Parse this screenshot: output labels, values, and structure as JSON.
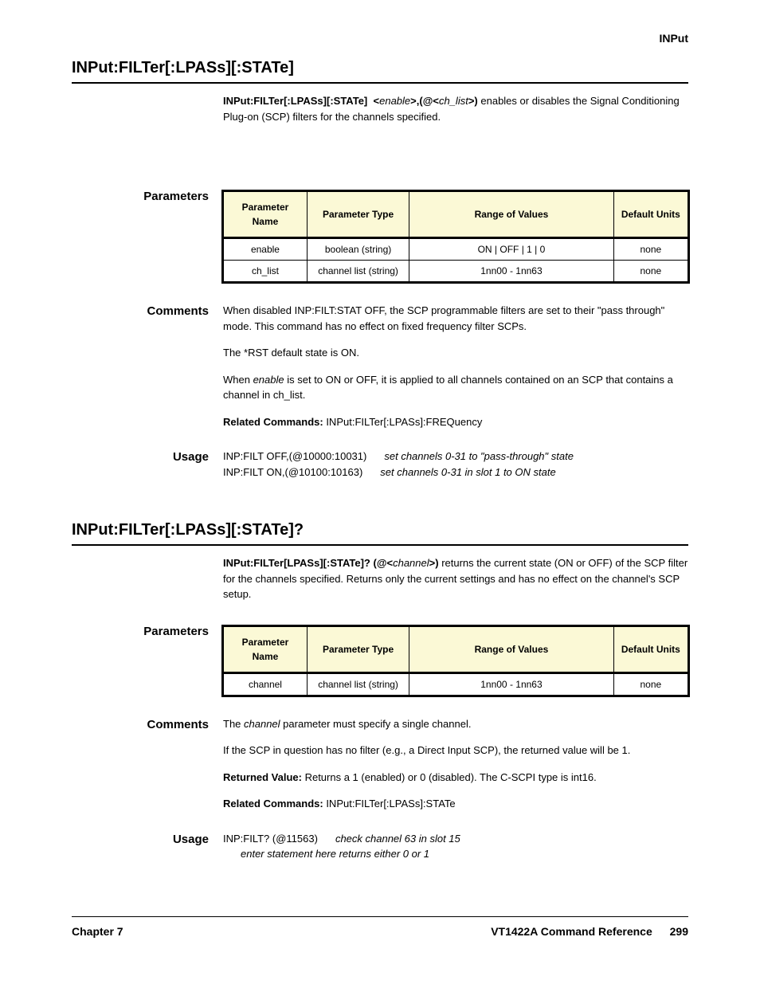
{
  "topLabel": "INPut",
  "section1": {
    "heading": "INPut:FILTer[:LPASs][:STATe]",
    "syntax": {
      "cmd": "INPut:FILTer[:LPASs][:STATe]",
      "arg1": "enable",
      "sep1": ",(@<",
      "arg2": "ch_list",
      "sep2": ">)"
    },
    "description": "enables or disables the Signal Conditioning Plug-on (SCP) filters for the channels specified.",
    "parametersLabel": "Parameters",
    "paramTable": {
      "headers": [
        "Parameter\nName",
        "Parameter\nType",
        "Range of\nValues",
        "Default\nUnits"
      ],
      "rows": [
        [
          "enable",
          "boolean (string)",
          "ON | OFF | 1 | 0",
          "none"
        ],
        [
          "ch_list",
          "channel list (string)",
          "1nn00 - 1nn63",
          "none"
        ]
      ]
    },
    "commentsLabel": "Comments",
    "comments": [
      {
        "prefix": "When disabled ",
        "bold1": "INP:FILT:STAT OFF",
        "mid": ", the SCP programmable filters are set to their \"pass through\" mode. This command has no effect on fixed frequency filter SCPs."
      },
      {
        "text": "The *RST default state is ON."
      },
      {
        "prefix": "When ",
        "ital": "enable",
        "mid": " is set to ON or OFF, it is applied to all channels contained on an SCP that contains a channel in ch_list."
      },
      {
        "type": "related",
        "label": "Related Commands:",
        "text": " INPut:FILTer[:LPASs]:FREQuency"
      }
    ],
    "usageLabel": "Usage",
    "usage": [
      {
        "cmd": "INP:FILT OFF,(@10000:10031)",
        "note": "set channels 0-31 to \"pass-through\" state"
      },
      {
        "cmd": "INP:FILT ON,(@10100:10163)",
        "note": "set channels 0-31 in slot 1 to ON state"
      }
    ]
  },
  "section2": {
    "heading": "INPut:FILTer[:LPASs][:STATe]?",
    "syntax": {
      "cmd": "INPut:FILTer[LPASs][:STATe]?",
      "pre": " (@<",
      "arg": "channel",
      "post": ">)"
    },
    "description": "returns the current state (ON or OFF) of the SCP filter for the channels specified. Returns only the current settings and has no effect on the channel's SCP setup.",
    "parametersLabel": "Parameters",
    "paramTable": {
      "headers": [
        "Parameter\nName",
        "Parameter\nType",
        "Range of\nValues",
        "Default\nUnits"
      ],
      "rows": [
        [
          "channel",
          "channel list (string)",
          "1nn00 - 1nn63",
          "none"
        ]
      ]
    },
    "commentsLabel": "Comments",
    "comments": [
      {
        "prefix": "The ",
        "ital": "channel",
        "mid": " parameter must specify a single channel."
      },
      {
        "text": "If the SCP in question has no filter (e.g., a Direct Input SCP), the returned value will be 1."
      },
      {
        "type": "returned",
        "label": "Returned Value:",
        "text": " Returns a 1 (enabled) or 0 (disabled). The C-SCPI type is int16."
      },
      {
        "type": "related",
        "label": "Related Commands:",
        "text": " INPut:FILTer[:LPASs]:STATe"
      }
    ],
    "usageLabel": "Usage",
    "usage": [
      {
        "cmd": "INP:FILT? (@11563)",
        "note": "check channel 63 in slot 15"
      },
      {
        "cmd": "",
        "note": "enter statement here returns either 0 or 1"
      }
    ]
  },
  "footer": {
    "left": "Chapter 7",
    "rightTitle": "VT1422A Command Reference",
    "pageNum": "299"
  }
}
